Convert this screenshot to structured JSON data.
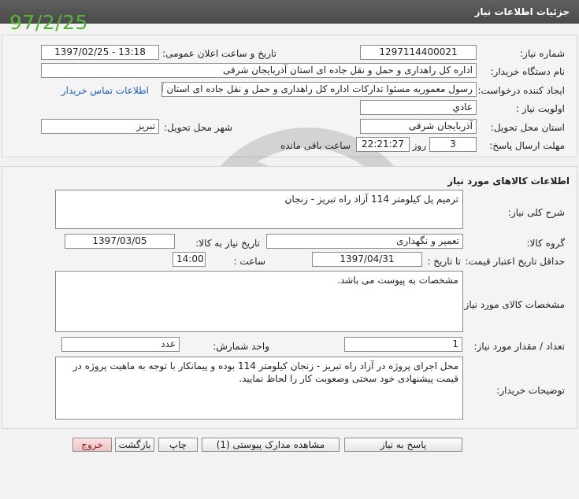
{
  "window": {
    "title": "جزئيات اطلاعات نياز"
  },
  "stamp": {
    "date": "97/2/25"
  },
  "header": {
    "need_number_label": "شماره نیاز:",
    "need_number": "1297114400021",
    "announce_label": "تاریخ و ساعت اعلان عمومی:",
    "announce_value": "1397/02/25 - 13:18",
    "buyer_label": "نام دستگاه خریدار:",
    "buyer_value": "اداره کل راهداری و حمل و نقل جاده ای استان آذربایجان شرقی",
    "creator_label": "ایجاد کننده درخواست:",
    "creator_value": "رسول معموریه مسئوا تدارکات اداره کل راهداری و حمل و نقل جاده ای استان آذر",
    "contact_link": "اطلاعات تماس خریدار",
    "priority_label": "اولویت نیاز :",
    "priority_value": "عادي",
    "province_label": "استان محل تحویل:",
    "province_value": "آذربایجان شرقی",
    "city_label": "شهر محل تحویل:",
    "city_value": "تبریز",
    "deadline_label": "مهلت ارسال پاسخ:",
    "days_value": "3",
    "days_unit": "روز و",
    "time_value": "22:21:27",
    "remaining_label": "ساعت باقی مانده"
  },
  "goods": {
    "section_title": "اطلاعات کالاهای مورد نیاز",
    "desc_label": "شرح کلی نیاز:",
    "desc_value": "ترمیم پل کیلومتر 114 آزاد راه تبریز - زنجان",
    "group_label": "گروه کالا:",
    "group_value": "تعمیر و نگهداری",
    "need_date_label": "تاریخ نیاز به کالا:",
    "need_date_value": "1397/03/05",
    "min_validity_label": "حداقل تاریخ اعتبار قیمت:",
    "to_date_label": "تا تاریخ :",
    "to_date_value": "1397/04/31",
    "hour_label": "ساعت :",
    "hour_value": "14:00",
    "spec_label": "مشخصات کالای مورد نیاز:",
    "spec_value": "مشخصات به پیوست می باشد.",
    "qty_label": "تعداد / مقدار مورد نیاز:",
    "qty_value": "1",
    "unit_label": "واحد شمارش:",
    "unit_value": "عدد",
    "buyer_notes_label": "توضیحات خریدار:",
    "buyer_notes_value": "محل اجرای پروژه در آزاد راه تبریز - زنجان کیلومتر 114 بوده و پیمانکار با توجه به  ماهیت پروژه  در قیمت پیشنهادی خود سختی وصعوبت کار را لحاظ نمایید."
  },
  "buttons": {
    "reply": "پاسخ به نیاز",
    "attachments": "مشاهده مدارک پیوستی (1)",
    "print": "چاپ",
    "back": "بازگشت",
    "exit": "خروج"
  }
}
